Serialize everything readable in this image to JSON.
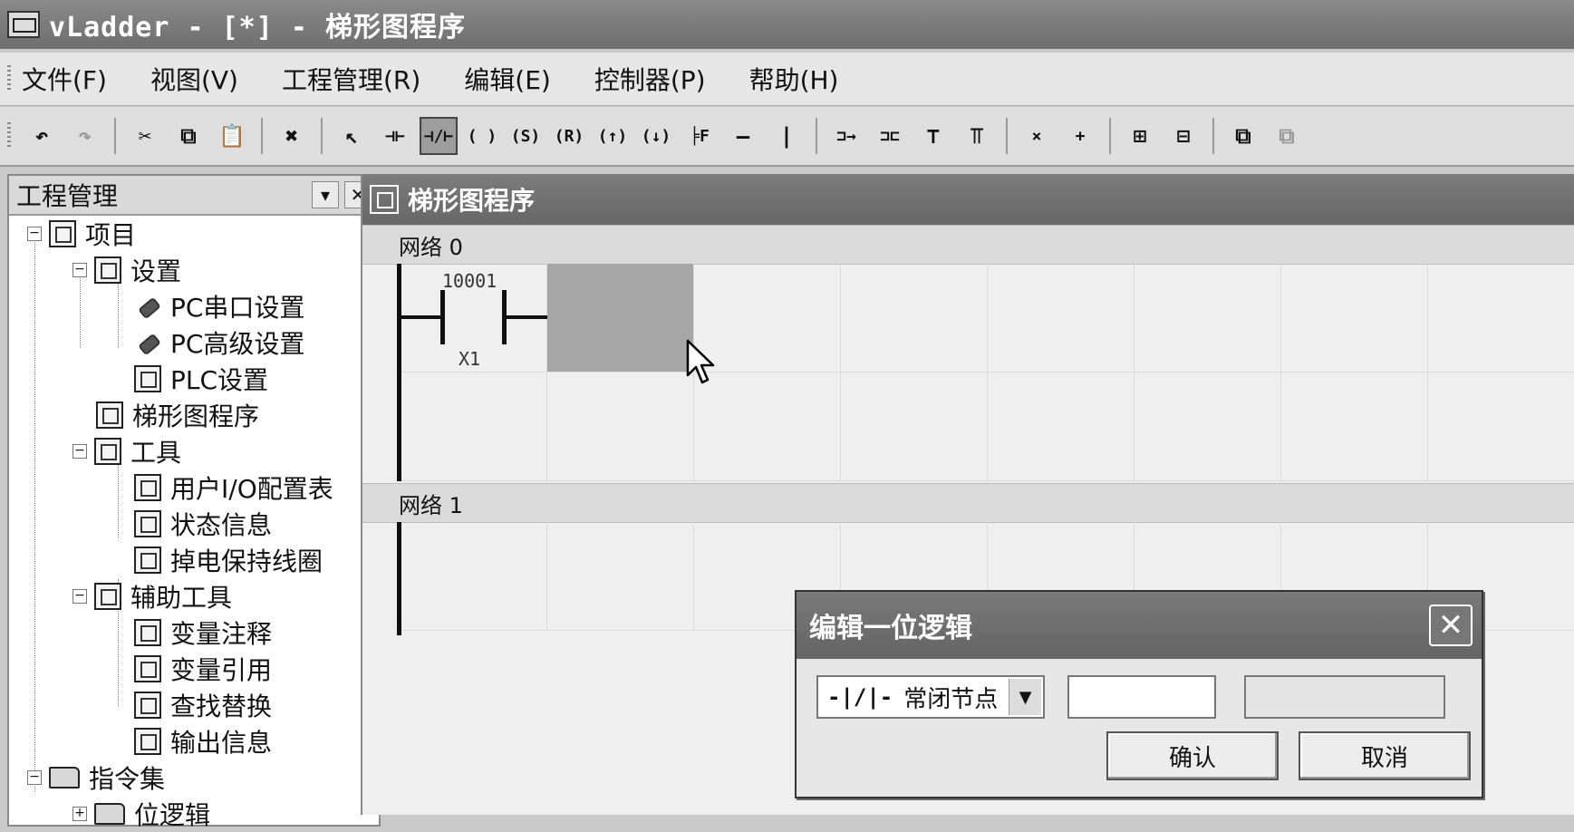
{
  "window": {
    "title": "vLadder - [*] - 梯形图程序"
  },
  "menu": [
    "文件(F)",
    "视图(V)",
    "工程管理(R)",
    "编辑(E)",
    "控制器(P)",
    "帮助(H)"
  ],
  "toolbar": {
    "undo": "↶",
    "redo": "↷",
    "cut": "✂",
    "copy": "⧉",
    "paste": "📋",
    "delete": "✖",
    "select": "↖",
    "no_contact": "⊣⊢",
    "nc_contact": "⊣/⊢",
    "coil": "( )",
    "set_coil": "(S)",
    "reset_coil": "(R)",
    "pos_coil": "(↑)",
    "neg_coil": "(↓)",
    "function_block": "╞F",
    "hline": "—",
    "vline": "|",
    "branch1": "⊐→",
    "branch2": "⊐⊏",
    "branch3": "⊤",
    "branch4": "⫪",
    "delete_col": "×",
    "insert_col": "+",
    "net1": "⊞",
    "net2": "⊟",
    "window1": "⧉",
    "window2": "⧉"
  },
  "project_panel": {
    "title": "工程管理",
    "tree": [
      {
        "label": "项目"
      },
      {
        "label": "设置"
      },
      {
        "label": "PC串口设置"
      },
      {
        "label": "PC高级设置"
      },
      {
        "label": "PLC设置"
      },
      {
        "label": "梯形图程序"
      },
      {
        "label": "工具"
      },
      {
        "label": "用户I/O配置表"
      },
      {
        "label": "状态信息"
      },
      {
        "label": "掉电保持线圈"
      },
      {
        "label": "辅助工具"
      },
      {
        "label": "变量注释"
      },
      {
        "label": "变量引用"
      },
      {
        "label": "查找替换"
      },
      {
        "label": "输出信息"
      },
      {
        "label": "指令集"
      },
      {
        "label": "位逻辑"
      }
    ]
  },
  "ladder": {
    "title": "梯形图程序",
    "networks": [
      {
        "label": "网络 0"
      },
      {
        "label": "网络 1"
      }
    ],
    "contact": {
      "address": "10001",
      "name": "X1"
    }
  },
  "dialog": {
    "title": "编辑一位逻辑",
    "close": "✕",
    "select_glyph": "-|/|-",
    "select_value": "常闭节点",
    "address_value": "",
    "value_field": "",
    "ok_label": "确认",
    "cancel_label": "取消"
  }
}
